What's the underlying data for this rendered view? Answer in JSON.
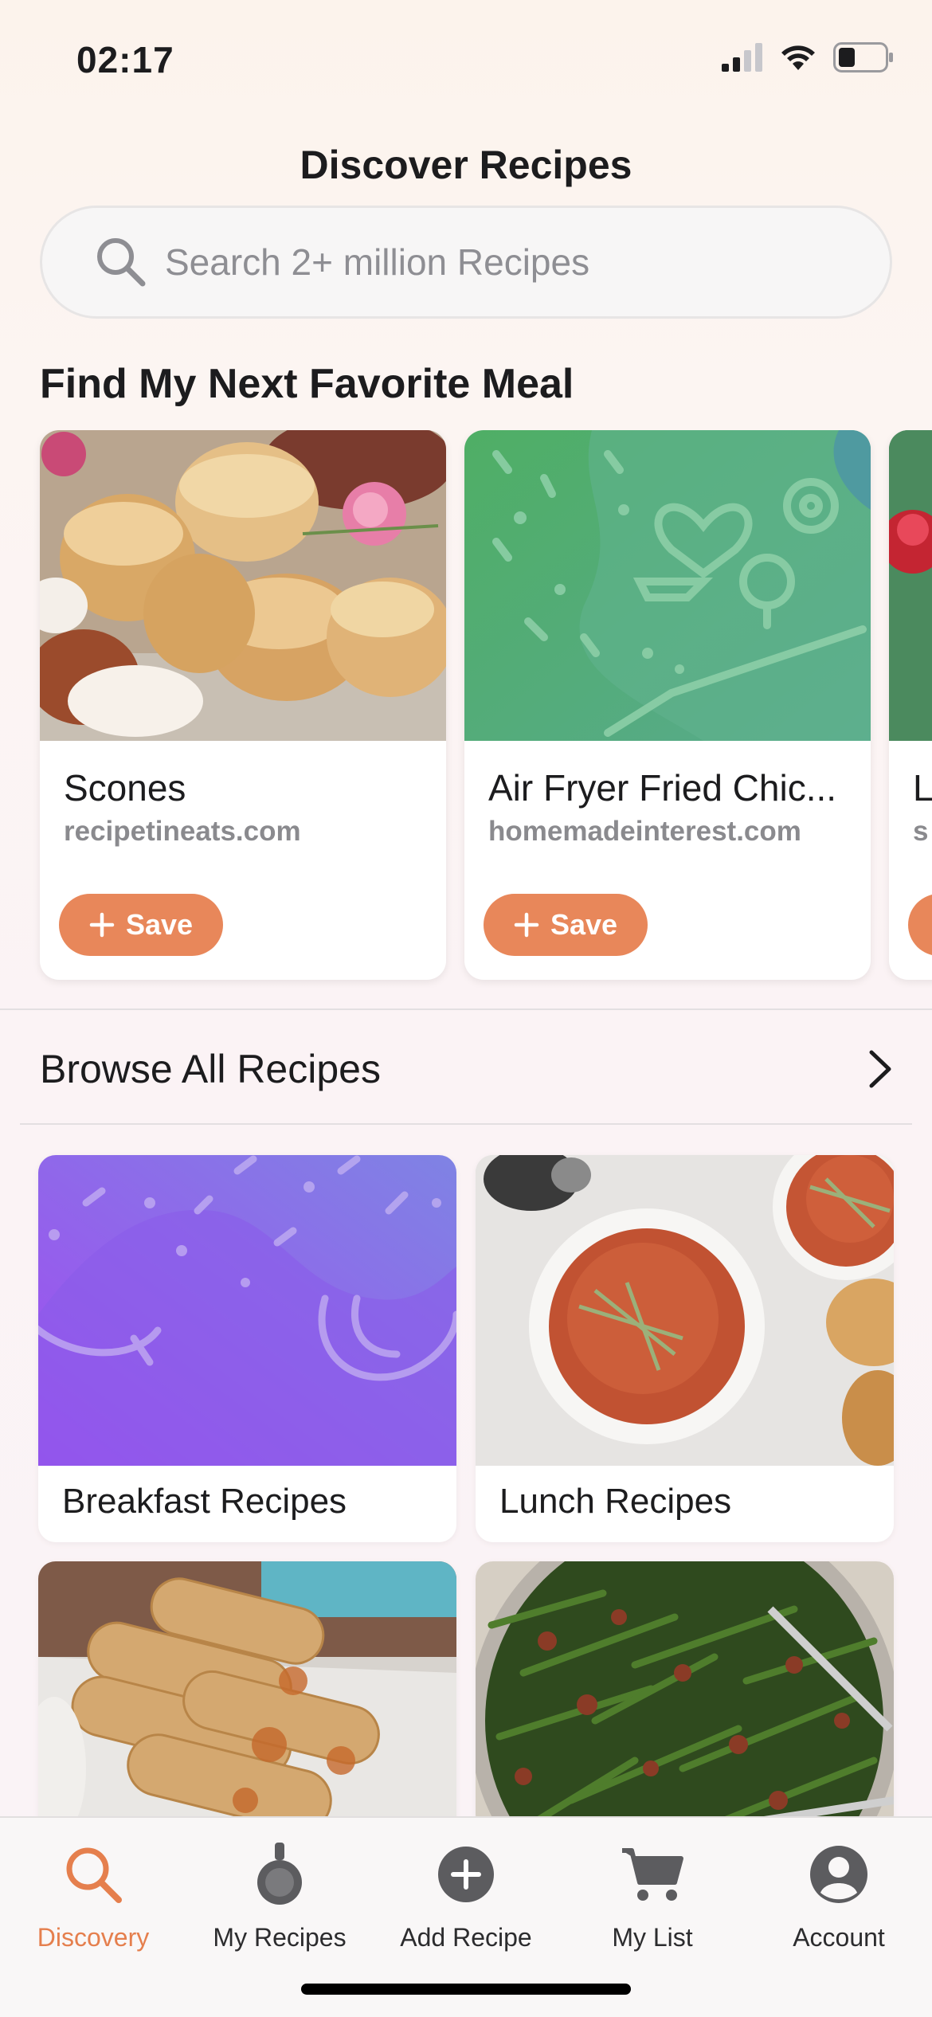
{
  "status_bar": {
    "time": "02:17"
  },
  "header": {
    "title": "Discover Recipes"
  },
  "search": {
    "placeholder": "Search 2+ million Recipes"
  },
  "featured": {
    "title": "Find My Next Favorite Meal",
    "cards": [
      {
        "title": "Scones",
        "source": "recipetineats.com",
        "save_label": "Save"
      },
      {
        "title": "Air Fryer Fried Chic...",
        "source": "homemadeinterest.com",
        "save_label": "Save"
      },
      {
        "title": "L",
        "source": "s",
        "save_label": ""
      }
    ]
  },
  "browse": {
    "label": "Browse All Recipes"
  },
  "categories": [
    {
      "label": "Breakfast Recipes"
    },
    {
      "label": "Lunch Recipes"
    },
    {
      "label": ""
    },
    {
      "label": ""
    }
  ],
  "tab_bar": {
    "items": [
      {
        "label": "Discovery",
        "icon": "search-icon",
        "active": true
      },
      {
        "label": "My Recipes",
        "icon": "pot-icon",
        "active": false
      },
      {
        "label": "Add Recipe",
        "icon": "add-circle-icon",
        "active": false
      },
      {
        "label": "My List",
        "icon": "cart-icon",
        "active": false
      },
      {
        "label": "Account",
        "icon": "person-icon",
        "active": false
      }
    ]
  },
  "colors": {
    "accent": "#e8875a",
    "active_tab": "#e57f4d",
    "purple_gradient_start": "#a252ee",
    "purple_gradient_end": "#6d6fe8",
    "green_placeholder": "#5aae7a"
  }
}
